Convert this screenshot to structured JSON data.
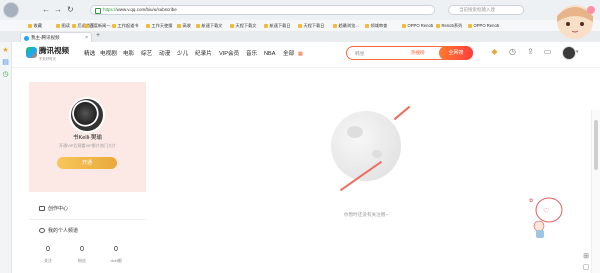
{
  "browser": {
    "nav_back": "←",
    "nav_forward": "→",
    "nav_refresh": "↻",
    "url_scheme": "https://",
    "url_rest": "www.v.qq.com/biu/u/subscribe",
    "search_placeholder": "当前搜索框输入建",
    "tab_title": "我主-腾讯视频",
    "new_tab": "+",
    "bookmarks": [
      "收藏",
      "图读",
      "后退首页",
      "百度新闻一...",
      "工作起道书",
      "工作天使搜",
      "高收",
      "航速下载文",
      "天程下载文",
      "航速下载日",
      "天程下载日",
      "趋最浏览...",
      "领域审查",
      "OPPO Reno5",
      "Reno5系列",
      "OPPO Reno5"
    ]
  },
  "site": {
    "logo_text": "腾讯视频",
    "logo_sub": "不负好时光",
    "nav": [
      "精选",
      "电视剧",
      "电影",
      "综艺",
      "动漫",
      "少儿",
      "纪录片",
      "VIP会员",
      "音乐",
      "NBA",
      "全部"
    ],
    "search_placeholder": "韩星",
    "search_hot": "热搜榜",
    "search_button": "全网搜",
    "header_icons": [
      "vip-icon",
      "history-icon",
      "upload-icon",
      "video-icon",
      "message-icon",
      "avatar"
    ]
  },
  "profile": {
    "username": "书Kelli·樊瑜",
    "description": "开通VIP后观看VIP影片热门大片",
    "open_button": "开通",
    "menu": [
      {
        "label": "创作中心"
      },
      {
        "label": "我的个人频道"
      }
    ],
    "stats": [
      {
        "value": "0",
        "label": "关注"
      },
      {
        "value": "0",
        "label": "粉丝"
      },
      {
        "value": "0",
        "label": "doki圈"
      }
    ]
  },
  "main": {
    "empty_text": "你暂时还没有关注哦~"
  },
  "colors": {
    "accent": "#ff5c2b",
    "vip_gold": "#e9a93c",
    "card_pink": "#fce9e6"
  }
}
